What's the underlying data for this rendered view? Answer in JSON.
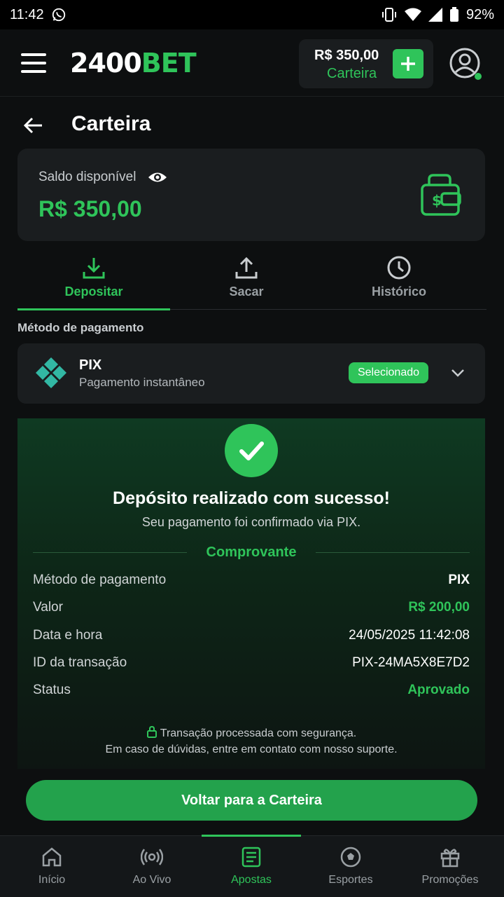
{
  "status_bar": {
    "time": "11:42",
    "battery": "92%"
  },
  "header": {
    "logo_white": "2400",
    "logo_green": "BET",
    "balance": "R$ 350,00",
    "wallet_label": "Carteira"
  },
  "page": {
    "title": "Carteira"
  },
  "balance_card": {
    "label": "Saldo disponível",
    "amount": "R$ 350,00"
  },
  "tabs": [
    {
      "label": "Depositar",
      "icon": "download-icon",
      "active": true
    },
    {
      "label": "Sacar",
      "icon": "upload-icon",
      "active": false
    },
    {
      "label": "Histórico",
      "icon": "clock-icon",
      "active": false
    }
  ],
  "payment": {
    "section_label": "Método de pagamento",
    "name": "PIX",
    "description": "Pagamento instantâneo",
    "badge": "Selecionado"
  },
  "success": {
    "title": "Depósito realizado com sucesso!",
    "subtitle": "Seu pagamento foi confirmado via PIX.",
    "receipt_title": "Comprovante",
    "rows": [
      {
        "key": "Método de pagamento",
        "value": "PIX"
      },
      {
        "key": "Valor",
        "value": "R$ 200,00"
      },
      {
        "key": "Data e hora",
        "value": "24/05/2025 11:42:08"
      },
      {
        "key": "ID da transação",
        "value": "PIX-24MA5X8E7D2"
      },
      {
        "key": "Status",
        "value": "Aprovado"
      }
    ],
    "secure_text": "Transação processada com segurança.",
    "support_text": "Em caso de dúvidas, entre em contato com nosso suporte."
  },
  "main_button": "Voltar para a Carteira",
  "bottom_nav": [
    {
      "label": "Início",
      "icon": "home-icon"
    },
    {
      "label": "Ao Vivo",
      "icon": "live-icon"
    },
    {
      "label": "Apostas",
      "icon": "bets-icon",
      "active": true
    },
    {
      "label": "Esportes",
      "icon": "sports-icon"
    },
    {
      "label": "Promoções",
      "icon": "gift-icon"
    }
  ],
  "colors": {
    "accent": "#2fc45a",
    "background": "#0d0f10",
    "card": "#1a1d1f"
  }
}
